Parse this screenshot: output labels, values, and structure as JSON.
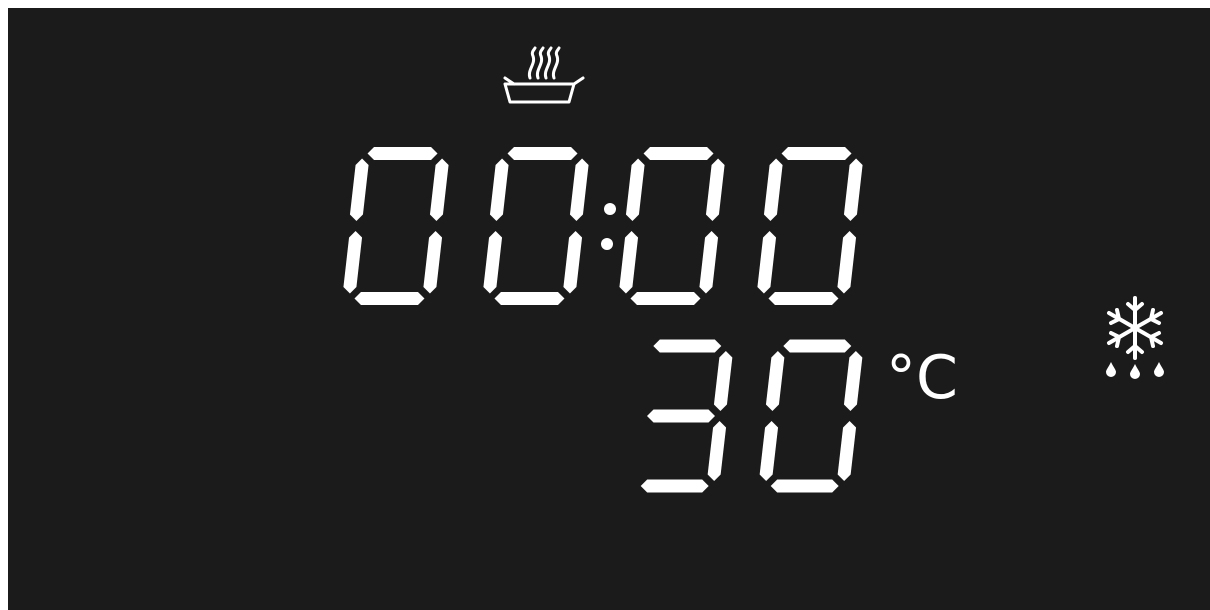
{
  "display": {
    "background": "#1b1b1b",
    "foreground": "#ffffff",
    "timer": {
      "digits": [
        "0",
        "0",
        "0",
        "0"
      ],
      "text": "00:00",
      "separator": ":"
    },
    "temperature": {
      "digits": [
        "3",
        "0"
      ],
      "value": 30,
      "unit": "°C"
    },
    "icons": {
      "top": "steam-dish-icon",
      "right": "defrost-snowflake-icon"
    }
  }
}
